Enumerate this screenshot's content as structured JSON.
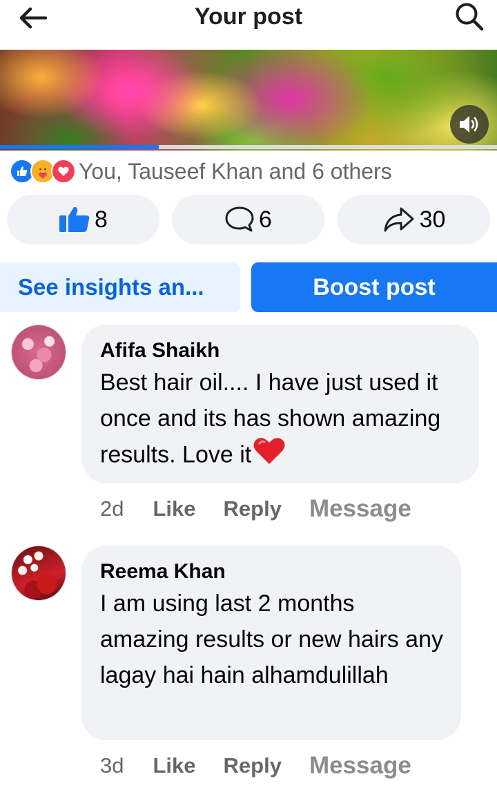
{
  "header": {
    "title": "Your post"
  },
  "video": {
    "progress": 0.32,
    "sound_icon": "speaker-icon"
  },
  "reactions": {
    "icons": [
      "like-reaction-icon",
      "care-reaction-icon",
      "love-reaction-icon"
    ],
    "summary": "You, Tauseef Khan and 6 others"
  },
  "actions": {
    "like_count": "8",
    "comment_count": "6",
    "share_count": "30"
  },
  "buttons": {
    "insights": "See insights an...",
    "boost": "Boost post"
  },
  "comments": [
    {
      "author": "Afifa Shaikh",
      "text": "Best hair oil.... I have just used it once and its has shown amazing results. Love it",
      "time": "2d",
      "like": "Like",
      "reply": "Reply",
      "message": "Message"
    },
    {
      "author": "Reema Khan",
      "text": "I am using last 2 months amazing results or new hairs any lagay hai hain alhamdulillah",
      "time": "3d",
      "like": "Like",
      "reply": "Reply",
      "message": "Message"
    }
  ],
  "colors": {
    "accent": "#1877f2",
    "pill_bg": "#f0f2f5",
    "secondary_text": "#65676b"
  }
}
